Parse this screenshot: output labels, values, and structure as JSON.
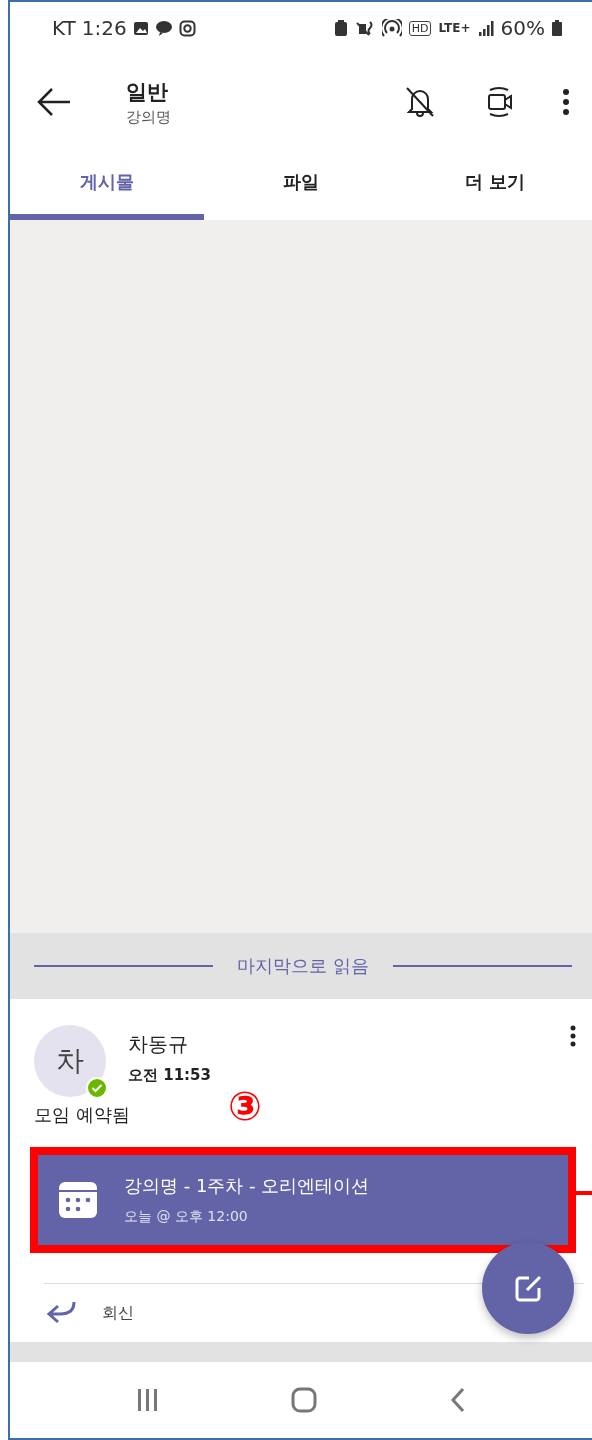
{
  "status_bar": {
    "carrier": "KT",
    "time": "1:26",
    "hd": "HD",
    "network": "LTE+",
    "battery": "60%"
  },
  "header": {
    "title": "일반",
    "subtitle": "강의명"
  },
  "tabs": [
    {
      "label": "게시물",
      "selected": true
    },
    {
      "label": "파일",
      "selected": false
    },
    {
      "label": "더 보기",
      "selected": false
    }
  ],
  "divider": {
    "label": "마지막으로 읽음"
  },
  "post": {
    "avatar": "차",
    "online": true,
    "author": "차동규",
    "time": "오전 11:53",
    "text": "모임 예약됨",
    "meeting": {
      "title": "강의명 - 1주차 - 오리엔테이션",
      "when": "오늘 @ 오후 12:00"
    },
    "reply": "회신"
  },
  "annotation": {
    "label": "③"
  }
}
